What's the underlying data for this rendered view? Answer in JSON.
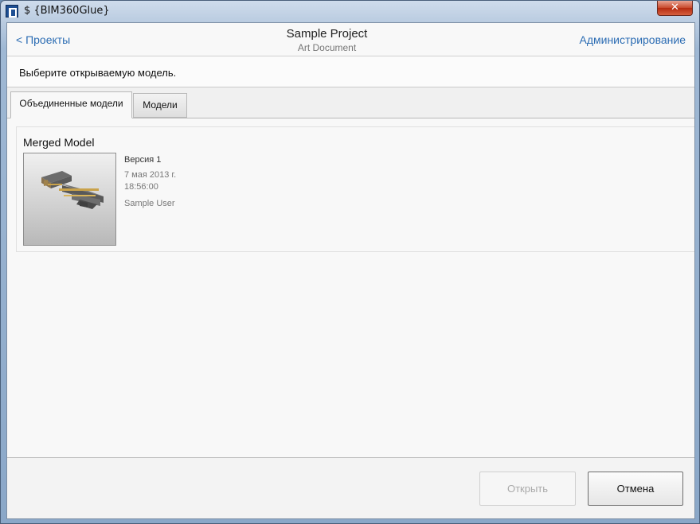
{
  "window": {
    "title": "$ {BIM360Glue}",
    "close_glyph": "✕",
    "app_icon": "bim360-app-icon"
  },
  "header": {
    "back_label": "< Проекты",
    "project_title": "Sample Project",
    "project_subtitle": "Art Document",
    "admin_label": "Администрирование"
  },
  "prompt": "Выберите открываемую модель.",
  "tabs": [
    {
      "label": "Объединенные модели",
      "active": true
    },
    {
      "label": "Модели",
      "active": false
    }
  ],
  "models": [
    {
      "name": "Merged Model",
      "version": "Версия 1",
      "date": "7 мая 2013 г.",
      "time": "18:56:00",
      "user": "Sample User"
    }
  ],
  "buttons": {
    "open_label": "Открыть",
    "open_enabled": false,
    "cancel_label": "Отмена"
  },
  "colors": {
    "link": "#2b6cb3",
    "close_button": "#c8482b"
  }
}
